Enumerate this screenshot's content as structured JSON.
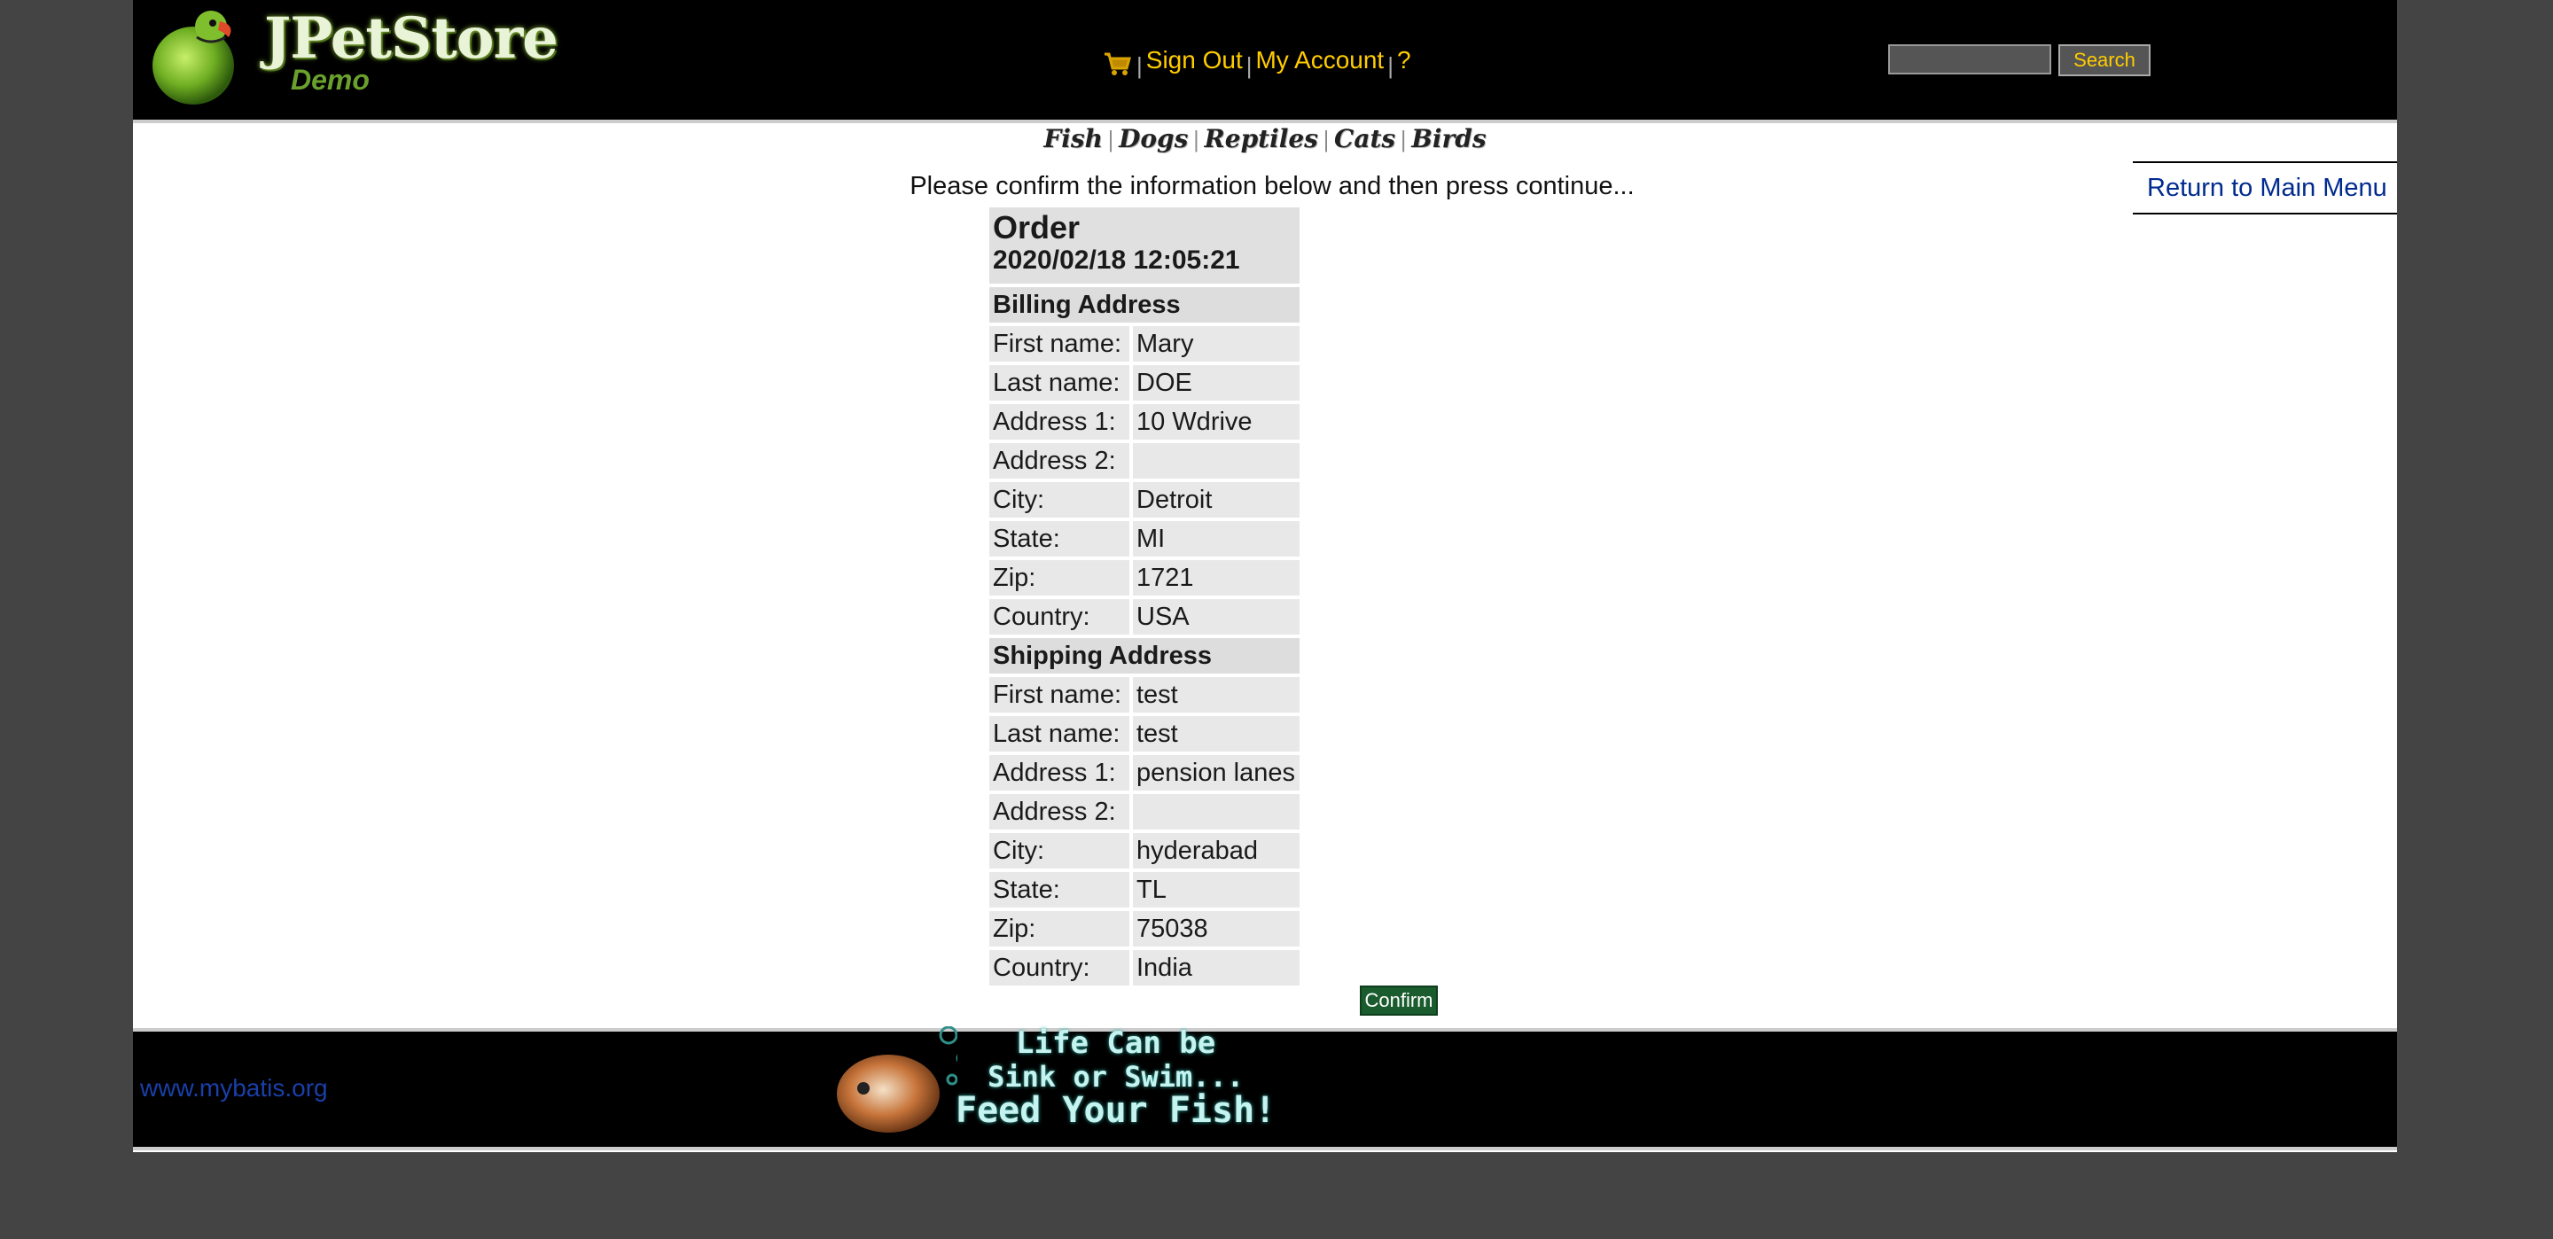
{
  "header": {
    "logo_title": "JPetStore",
    "logo_subtitle": "Demo",
    "menu": {
      "sign_out": "Sign Out",
      "my_account": "My Account",
      "help": "?",
      "separator": "|"
    },
    "search": {
      "placeholder": "",
      "button_label": "Search"
    }
  },
  "quick_links": [
    "Fish",
    "Dogs",
    "Reptiles",
    "Cats",
    "Birds"
  ],
  "quick_links_separator": "|",
  "return_link": "Return to Main Menu",
  "confirm_message": "Please confirm the information below and then press continue...",
  "order": {
    "title": "Order",
    "datetime": "2020/02/18 12:05:21",
    "billing": {
      "heading": "Billing Address",
      "rows": [
        {
          "label": "First name:",
          "value": "Mary"
        },
        {
          "label": "Last name:",
          "value": "DOE"
        },
        {
          "label": "Address 1:",
          "value": "10 Wdrive"
        },
        {
          "label": "Address 2:",
          "value": ""
        },
        {
          "label": "City:",
          "value": "Detroit"
        },
        {
          "label": "State:",
          "value": "MI"
        },
        {
          "label": "Zip:",
          "value": "1721"
        },
        {
          "label": "Country:",
          "value": "USA"
        }
      ]
    },
    "shipping": {
      "heading": "Shipping Address",
      "rows": [
        {
          "label": "First name:",
          "value": "test"
        },
        {
          "label": "Last name:",
          "value": "test"
        },
        {
          "label": "Address 1:",
          "value": "pension lanes"
        },
        {
          "label": "Address 2:",
          "value": ""
        },
        {
          "label": "City:",
          "value": "hyderabad"
        },
        {
          "label": "State:",
          "value": "TL"
        },
        {
          "label": "Zip:",
          "value": "75038"
        },
        {
          "label": "Country:",
          "value": "India"
        }
      ]
    }
  },
  "confirm_button_label": "Confirm",
  "footer": {
    "link": "www.mybatis.org",
    "banner_line1": "Life Can be",
    "banner_line2": "Sink or Swim...",
    "banner_line3": "Feed Your Fish!"
  },
  "colors": {
    "page_background": "#444444",
    "header_background": "#000000",
    "menu_link": "#ffcc00",
    "return_link": "#002a8f",
    "confirm_button": "#1a5c2e",
    "footer_link": "#1a3fa8"
  },
  "icons": {
    "cart": "shopping-cart-icon",
    "logo": "parrot-logo-icon",
    "banner": "fish-banner-icon"
  }
}
